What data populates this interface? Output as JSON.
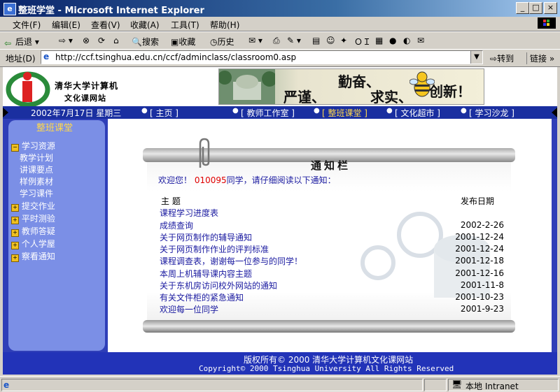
{
  "window": {
    "title": "整班学堂 - Microsoft Internet Explorer"
  },
  "menu": [
    "文件(F)",
    "编辑(E)",
    "查看(V)",
    "收藏(A)",
    "工具(T)",
    "帮助(H)"
  ],
  "toolbar": {
    "back": "后退",
    "search": "搜索",
    "favorites": "收藏",
    "history": "历史"
  },
  "address": {
    "label": "地址(D)",
    "url": "http://ccf.tsinghua.edu.cn/ccf/adminclass/classroom0.asp",
    "go": "转到",
    "links": "链接"
  },
  "site": {
    "logo_line1": "清华大学计算机",
    "logo_line2": "文化课网站",
    "slogan": [
      "严谨、",
      "勤奋、",
      "求实、",
      "创新！"
    ],
    "date": "2002年7月17日  星期三",
    "nav": [
      "[ 主页 ]",
      "[ 教师工作室 ]",
      "[ 整班课堂 ]",
      "[ 文化超市 ]",
      "[ 学习沙龙 ]"
    ],
    "sidebar_title": "整班课堂",
    "sidebar": [
      {
        "label": "学习资源",
        "type": "folder-open"
      },
      {
        "label": "教学计划",
        "type": "sub"
      },
      {
        "label": "讲课要点",
        "type": "sub"
      },
      {
        "label": "样例素材",
        "type": "sub"
      },
      {
        "label": "学习课件",
        "type": "sub"
      },
      {
        "label": "提交作业",
        "type": "folder"
      },
      {
        "label": "平时测验",
        "type": "folder"
      },
      {
        "label": "教师答疑",
        "type": "folder"
      },
      {
        "label": "个人学屋",
        "type": "folder"
      },
      {
        "label": "察看通知",
        "type": "folder"
      }
    ],
    "board_title": "通知栏",
    "welcome_pre": "欢迎您！",
    "student_id": "010095",
    "welcome_post": "同学，请仔细阅读以下通知：",
    "col_subject": "主  题",
    "col_date": "发布日期",
    "notices": [
      {
        "title": "课程学习进度表",
        "date": ""
      },
      {
        "title": "成绩查询",
        "date": "2002-2-26"
      },
      {
        "title": "关于网页制作的辅导通知",
        "date": "2001-12-24"
      },
      {
        "title": "关于网页制作作业的评判标准",
        "date": "2001-12-24"
      },
      {
        "title": "课程调查表，谢谢每一位参与的同学！",
        "date": "2001-12-18"
      },
      {
        "title": "本周上机辅导课内容主题",
        "date": "2001-12-16"
      },
      {
        "title": "关于东机房访问校外网站的通知",
        "date": "2001-11-8"
      },
      {
        "title": "有关文件柜的紧急通知",
        "date": "2001-10-23"
      },
      {
        "title": "欢迎每一位同学",
        "date": "2001-9-23"
      }
    ],
    "footer_cn": "版权所有© 2000 清华大学计算机文化课网站",
    "footer_en": "Copyright© 2000 Tsinghua University All Rights Reserved"
  },
  "status": {
    "zone": "本地 Intranet"
  }
}
